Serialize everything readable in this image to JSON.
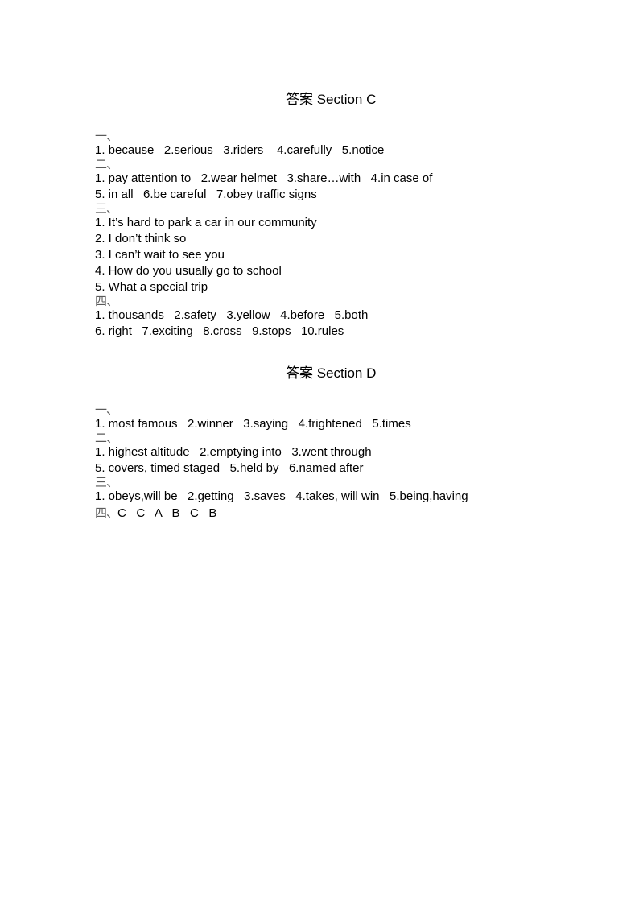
{
  "document": {
    "page_background": "#ffffff",
    "text_color": "#000000",
    "marker_color": "#5a5a5a"
  },
  "sections": [
    {
      "id": "section-c",
      "heading": "答案 Section C",
      "heading_cn": "答案",
      "heading_en": "Section C",
      "parts": [
        {
          "marker": "一、",
          "lines": [
            "1. because   2.serious   3.riders    4.carefully   5.notice"
          ]
        },
        {
          "marker": "二、",
          "lines": [
            "1. pay attention to   2.wear helmet   3.share…with   4.in case of",
            "5. in all   6.be careful   7.obey traffic signs"
          ]
        },
        {
          "marker": "三、",
          "lines": [
            "1. It’s hard to park a car in our community",
            "2. I don’t think so",
            "3. I can’t wait to see you",
            "4. How do you usually go to school",
            "5. What a special trip"
          ]
        },
        {
          "marker": "四、",
          "lines": [
            "1. thousands   2.safety   3.yellow   4.before   5.both",
            "6. right   7.exciting   8.cross   9.stops   10.rules"
          ]
        }
      ]
    },
    {
      "id": "section-d",
      "heading": "答案 Section D",
      "heading_cn": "答案",
      "heading_en": "Section D",
      "parts": [
        {
          "marker": "一、",
          "lines": [
            "1. most famous   2.winner   3.saying   4.frightened   5.times"
          ]
        },
        {
          "marker": "二、",
          "lines": [
            "1. highest altitude   2.emptying into   3.went through",
            "5. covers, timed staged   5.held by   6.named after"
          ]
        },
        {
          "marker": "三、",
          "lines": [
            "1. obeys,will be   2.getting   3.saves   4.takes, will win   5.being,having"
          ]
        }
      ],
      "inline_part": {
        "marker": "四、",
        "answers": "C   C   A   B   C   B"
      }
    }
  ]
}
